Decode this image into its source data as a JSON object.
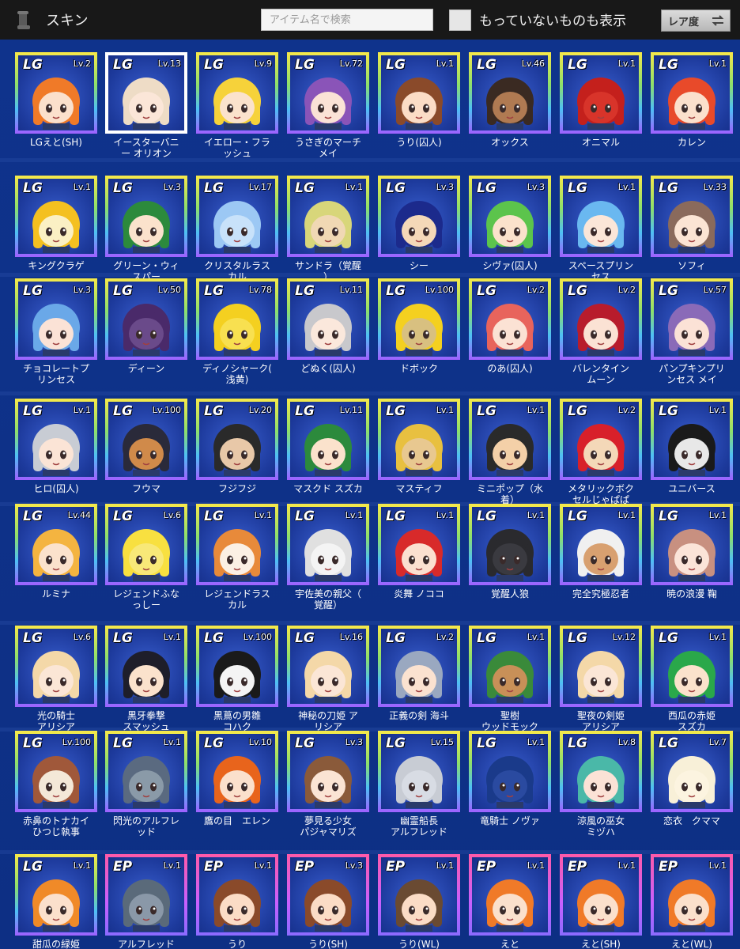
{
  "header": {
    "title": "スキン",
    "search_placeholder": "アイテム名で検索",
    "show_unowned_label": "もっていないものも表示",
    "sort_label": "レア度"
  },
  "skins": [
    {
      "name": "LGえと(SH)",
      "rarity": "LG",
      "level": "Lv.2",
      "hair": "#f07a28",
      "skin": "#fbe0cc"
    },
    {
      "name": "イースターバニ\nー オリオン",
      "rarity": "LG",
      "level": "Lv.13",
      "hair": "#eedcc6",
      "skin": "#fbe6d8",
      "selected": true
    },
    {
      "name": "イエロー・フラ\nッシュ",
      "rarity": "LG",
      "level": "Lv.9",
      "hair": "#f6d23a",
      "skin": "#fbe2cc"
    },
    {
      "name": "うさぎのマーチ\nメイ",
      "rarity": "LG",
      "level": "Lv.72",
      "hair": "#8a54b8",
      "skin": "#fbe2d6"
    },
    {
      "name": "うり(囚人)",
      "rarity": "LG",
      "level": "Lv.1",
      "hair": "#8a4a2a",
      "skin": "#fbdcc6"
    },
    {
      "name": "オックス",
      "rarity": "LG",
      "level": "Lv.46",
      "hair": "#3a2a22",
      "skin": "#b07a52"
    },
    {
      "name": "オニマル",
      "rarity": "LG",
      "level": "Lv.1",
      "hair": "#c4201c",
      "skin": "#d8342a"
    },
    {
      "name": "カレン",
      "rarity": "LG",
      "level": "Lv.1",
      "hair": "#e84a2a",
      "skin": "#fbe0cc"
    },
    {
      "name": "キングクラゲ",
      "rarity": "LG",
      "level": "Lv.1",
      "hair": "#f4c020",
      "skin": "#fbf0c4"
    },
    {
      "name": "グリーン・ウィ\nスパー",
      "rarity": "LG",
      "level": "Lv.3",
      "hair": "#2c8a3c",
      "skin": "#fbe2cc"
    },
    {
      "name": "クリスタルラス\nカル",
      "rarity": "LG",
      "level": "Lv.17",
      "hair": "#9cc8f4",
      "skin": "#c8e2fa"
    },
    {
      "name": "サンドラ（覚醒\n）",
      "rarity": "LG",
      "level": "Lv.1",
      "hair": "#d8d67a",
      "skin": "#f0d8b4"
    },
    {
      "name": "シー",
      "rarity": "LG",
      "level": "Lv.3",
      "hair": "#1c2a8c",
      "skin": "#f4d8b8"
    },
    {
      "name": "シヴァ(囚人)",
      "rarity": "LG",
      "level": "Lv.3",
      "hair": "#5cc44c",
      "skin": "#fbe2cc"
    },
    {
      "name": "スペースプリン\nセス",
      "rarity": "LG",
      "level": "Lv.1",
      "hair": "#6ab8f0",
      "skin": "#fbe6d8"
    },
    {
      "name": "ソフィ",
      "rarity": "LG",
      "level": "Lv.33",
      "hair": "#8a6a5c",
      "skin": "#fbe4d4"
    },
    {
      "name": "チョコレートプ\nリンセス",
      "rarity": "LG",
      "level": "Lv.3",
      "hair": "#6aa8e8",
      "skin": "#fbe2d6"
    },
    {
      "name": "ディーン",
      "rarity": "LG",
      "level": "Lv.50",
      "hair": "#4a2a6a",
      "skin": "#6a4a8a"
    },
    {
      "name": "ディノシャーク(\n浅黄)",
      "rarity": "LG",
      "level": "Lv.78",
      "hair": "#f4d020",
      "skin": "#f8e050"
    },
    {
      "name": "どぬく(囚人)",
      "rarity": "LG",
      "level": "Lv.11",
      "hair": "#c8c8cc",
      "skin": "#fbe8dc"
    },
    {
      "name": "ドボック",
      "rarity": "LG",
      "level": "Lv.100",
      "hair": "#f4d020",
      "skin": "#d8c080"
    },
    {
      "name": "のあ(囚人)",
      "rarity": "LG",
      "level": "Lv.2",
      "hair": "#e8645c",
      "skin": "#fbe2d4"
    },
    {
      "name": "バレンタイン\nムーン",
      "rarity": "LG",
      "level": "Lv.2",
      "hair": "#b81c2c",
      "skin": "#fbe2d4"
    },
    {
      "name": "パンプキンプリ\nンセス メイ",
      "rarity": "LG",
      "level": "Lv.57",
      "hair": "#8a6ab8",
      "skin": "#fbe2d6"
    },
    {
      "name": "ヒロ(囚人)",
      "rarity": "LG",
      "level": "Lv.1",
      "hair": "#c8ccd4",
      "skin": "#fbe4d6"
    },
    {
      "name": "フウマ",
      "rarity": "LG",
      "level": "Lv.100",
      "hair": "#2a2a3a",
      "skin": "#d08a4a"
    },
    {
      "name": "フジフジ",
      "rarity": "LG",
      "level": "Lv.20",
      "hair": "#2a2a2a",
      "skin": "#e8c8a8"
    },
    {
      "name": "マスクド スズカ",
      "rarity": "LG",
      "level": "Lv.11",
      "hair": "#2c8a3c",
      "skin": "#fbe2cc"
    },
    {
      "name": "マスティフ",
      "rarity": "LG",
      "level": "Lv.1",
      "hair": "#e8c040",
      "skin": "#e8c890"
    },
    {
      "name": "ミニポップ（水\n着）",
      "rarity": "LG",
      "level": "Lv.1",
      "hair": "#2a2a2a",
      "skin": "#f4d0a8"
    },
    {
      "name": "メタリックボク\nセルじゃぱぱ",
      "rarity": "LG",
      "level": "Lv.2",
      "hair": "#d8202a",
      "skin": "#f4d8b8"
    },
    {
      "name": "ユニバース",
      "rarity": "LG",
      "level": "Lv.1",
      "hair": "#1a1a1a",
      "skin": "#e8e8e8"
    },
    {
      "name": "ルミナ",
      "rarity": "LG",
      "level": "Lv.44",
      "hair": "#f4b440",
      "skin": "#fbe2cc"
    },
    {
      "name": "レジェンドふな\nっしー",
      "rarity": "LG",
      "level": "Lv.6",
      "hair": "#f8e040",
      "skin": "#f8e878"
    },
    {
      "name": "レジェンドラス\nカル",
      "rarity": "LG",
      "level": "Lv.1",
      "hair": "#e88a3a",
      "skin": "#fbf0e4"
    },
    {
      "name": "宇佐美の親父（\n覚醒）",
      "rarity": "LG",
      "level": "Lv.1",
      "hair": "#e0e0e0",
      "skin": "#f4f4f4"
    },
    {
      "name": "炎舞 ノココ",
      "rarity": "LG",
      "level": "Lv.1",
      "hair": "#d82a2a",
      "skin": "#fbe0d0"
    },
    {
      "name": "覚醒人狼",
      "rarity": "LG",
      "level": "Lv.1",
      "hair": "#2a2a2e",
      "skin": "#3a3a40"
    },
    {
      "name": "完全究極忍者",
      "rarity": "LG",
      "level": "Lv.1",
      "hair": "#f0f0f0",
      "skin": "#d8a070"
    },
    {
      "name": "暁の浪漫 鞠",
      "rarity": "LG",
      "level": "Lv.1",
      "hair": "#c89080",
      "skin": "#fbe4d8"
    },
    {
      "name": "光の騎士\nアリシア",
      "rarity": "LG",
      "level": "Lv.6",
      "hair": "#f4d8a8",
      "skin": "#fbe6d6"
    },
    {
      "name": "黒牙拳撃\nスマッシュ",
      "rarity": "LG",
      "level": "Lv.1",
      "hair": "#1e1e2a",
      "skin": "#fbe2cc"
    },
    {
      "name": "黒蔦の男雛\nコハク",
      "rarity": "LG",
      "level": "Lv.100",
      "hair": "#1a1a1a",
      "skin": "#f4f4f4"
    },
    {
      "name": "神秘の刀姫 ア\nリシア",
      "rarity": "LG",
      "level": "Lv.16",
      "hair": "#f4d8a8",
      "skin": "#fbe6d6"
    },
    {
      "name": "正義の剣 海斗",
      "rarity": "LG",
      "level": "Lv.2",
      "hair": "#9aa8c0",
      "skin": "#fbe2d0"
    },
    {
      "name": "聖樹\nウッドモック",
      "rarity": "LG",
      "level": "Lv.1",
      "hair": "#3a8a3a",
      "skin": "#c89058"
    },
    {
      "name": "聖夜の剣姫\nアリシア",
      "rarity": "LG",
      "level": "Lv.12",
      "hair": "#f4d8a8",
      "skin": "#fbe6d6"
    },
    {
      "name": "西瓜の赤姫\nスズカ",
      "rarity": "LG",
      "level": "Lv.1",
      "hair": "#2aa84a",
      "skin": "#fbe2cc"
    },
    {
      "name": "赤鼻のトナカイ\nひつじ執事",
      "rarity": "LG",
      "level": "Lv.100",
      "hair": "#a0583a",
      "skin": "#f4e8d8"
    },
    {
      "name": "閃光のアルフレ\nッド",
      "rarity": "LG",
      "level": "Lv.1",
      "hair": "#5a6a80",
      "skin": "#8a9aa8"
    },
    {
      "name": "鷹の目　エレン",
      "rarity": "LG",
      "level": "Lv.10",
      "hair": "#e8641c",
      "skin": "#fbe0cc"
    },
    {
      "name": "夢見る少女\nパジャマリズ",
      "rarity": "LG",
      "level": "Lv.3",
      "hair": "#8a5a3a",
      "skin": "#fbe4d4"
    },
    {
      "name": "幽霊船長\nアルフレッド",
      "rarity": "LG",
      "level": "Lv.15",
      "hair": "#c8ccd4",
      "skin": "#d8dce4"
    },
    {
      "name": "竜騎士 ノヴァ",
      "rarity": "LG",
      "level": "Lv.1",
      "hair": "#1a3a8a",
      "skin": "#2a4aa0"
    },
    {
      "name": "涼風の巫女\nミヅハ",
      "rarity": "LG",
      "level": "Lv.8",
      "hair": "#4ab8a8",
      "skin": "#fbe2d6"
    },
    {
      "name": "恋衣　クママ",
      "rarity": "LG",
      "level": "Lv.7",
      "hair": "#f8f0d8",
      "skin": "#fcf4e0"
    },
    {
      "name": "甜瓜の緑姫",
      "rarity": "LG",
      "level": "Lv.1",
      "hair": "#f08a28",
      "skin": "#fbe0cc"
    },
    {
      "name": "アルフレッド",
      "rarity": "EP",
      "level": "Lv.1",
      "hair": "#5a6a7a",
      "skin": "#8a98a8"
    },
    {
      "name": "うり",
      "rarity": "EP",
      "level": "Lv.1",
      "hair": "#8a4a2a",
      "skin": "#fbdcc6"
    },
    {
      "name": "うり(SH)",
      "rarity": "EP",
      "level": "Lv.3",
      "hair": "#8a4a2a",
      "skin": "#fbdcc6"
    },
    {
      "name": "うり(WL)",
      "rarity": "EP",
      "level": "Lv.1",
      "hair": "#6a4a32",
      "skin": "#fbdcc6"
    },
    {
      "name": "えと",
      "rarity": "EP",
      "level": "Lv.1",
      "hair": "#f07a28",
      "skin": "#fbe0cc"
    },
    {
      "name": "えと(SH)",
      "rarity": "EP",
      "level": "Lv.1",
      "hair": "#f07a28",
      "skin": "#fbe0cc"
    },
    {
      "name": "えと(WL)",
      "rarity": "EP",
      "level": "Lv.1",
      "hair": "#f07a28",
      "skin": "#fbe0cc"
    }
  ]
}
